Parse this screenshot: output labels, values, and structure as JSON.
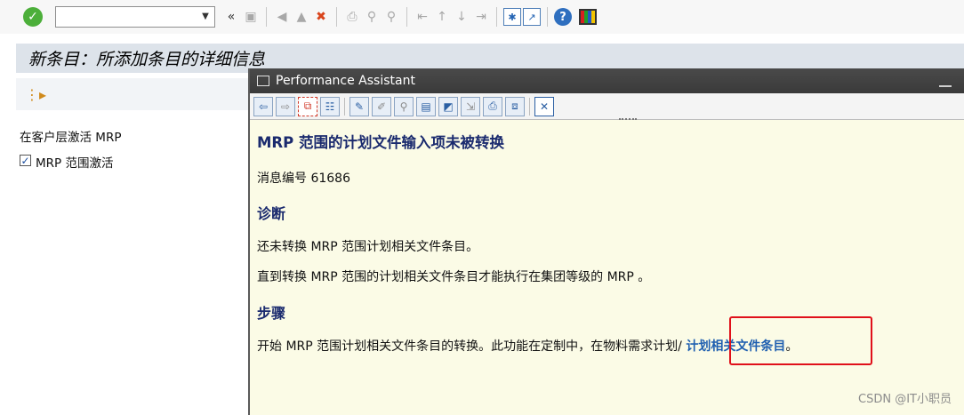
{
  "toolbar": {
    "command_field_value": ""
  },
  "title": "新条目：所添加条目的详细信息",
  "app": {
    "section_label": "在客户层激活 MRP",
    "checkbox_label": "MRP 范围激活",
    "checkbox_checked": true
  },
  "performance_assistant": {
    "window_title": "Performance Assistant",
    "heading": "MRP 范围的计划文件输入项未被转换",
    "message_number": "消息编号 61686",
    "diagnosis_heading": "诊断",
    "diagnosis_line1": "还未转换 MRP 范围计划相关文件条目。",
    "diagnosis_line2": "直到转换 MRP 范围的计划相关文件条目才能执行在集团等级的 MRP 。",
    "steps_heading": "步骤",
    "steps_text": "开始 MRP 范围计划相关文件条目的转换。此功能在定制中，在物料需求计划/ ",
    "steps_link": "计划相关文件条目",
    "steps_end": "。"
  },
  "watermark": "CSDN @IT小职员",
  "colors": {
    "highlight": "#e0101a",
    "link": "#1f5fb0",
    "heading": "#1a2a6e",
    "panel_bg": "#fbfbe6"
  }
}
